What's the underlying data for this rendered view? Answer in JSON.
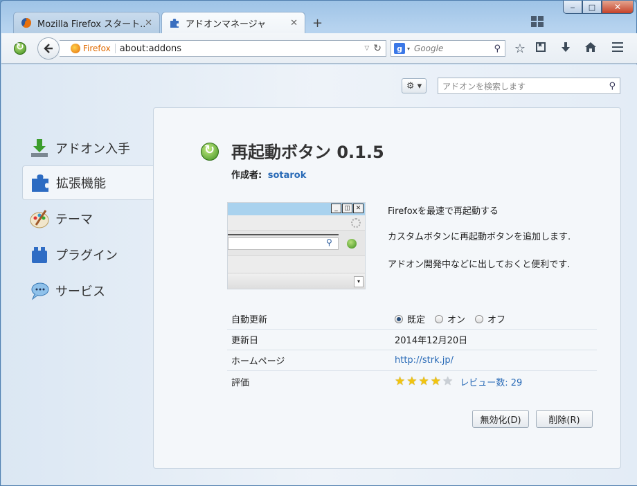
{
  "window": {
    "caption": {
      "minimize": "‒",
      "maximize": "□",
      "close": "✕"
    }
  },
  "tabs": [
    {
      "label": "Mozilla Firefox スタート...",
      "close": "✕",
      "icon": "firefox-icon"
    },
    {
      "label": "アドオンマネージャ",
      "close": "✕",
      "icon": "puzzle-icon"
    }
  ],
  "tab_new": "+",
  "navbar": {
    "identity_label": "Firefox",
    "url": "about:addons",
    "search_placeholder": "Google",
    "search_engine_glyph": "g"
  },
  "toolbar": {
    "gear": "⚙ ▾",
    "search_placeholder": "アドオンを検索します"
  },
  "categories": [
    {
      "label": "アドオン入手",
      "icon": "get-addons-icon",
      "selected": false
    },
    {
      "label": "拡張機能",
      "icon": "extensions-icon",
      "selected": true
    },
    {
      "label": "テーマ",
      "icon": "themes-icon",
      "selected": false
    },
    {
      "label": "プラグイン",
      "icon": "plugins-icon",
      "selected": false
    },
    {
      "label": "サービス",
      "icon": "services-icon",
      "selected": false
    }
  ],
  "addon": {
    "title": "再起動ボタン 0.1.5",
    "author_label": "作成者:",
    "author": "sotarok",
    "description": [
      "Firefoxを最速で再起動する",
      "カスタムボタンに再起動ボタンを追加します.",
      "アドオン開発中などに出しておくと便利です."
    ],
    "details": {
      "auto_update_label": "自動更新",
      "auto_update_options": [
        "既定",
        "オン",
        "オフ"
      ],
      "auto_update_selected": "既定",
      "updated_label": "更新日",
      "updated_value": "2014年12月20日",
      "homepage_label": "ホームページ",
      "homepage_value": "http://strk.jp/",
      "rating_label": "評価",
      "rating_stars": 4,
      "rating_max": 5,
      "reviews_text": "レビュー数: 29"
    },
    "buttons": {
      "disable": "無効化(D)",
      "remove": "削除(R)"
    }
  }
}
